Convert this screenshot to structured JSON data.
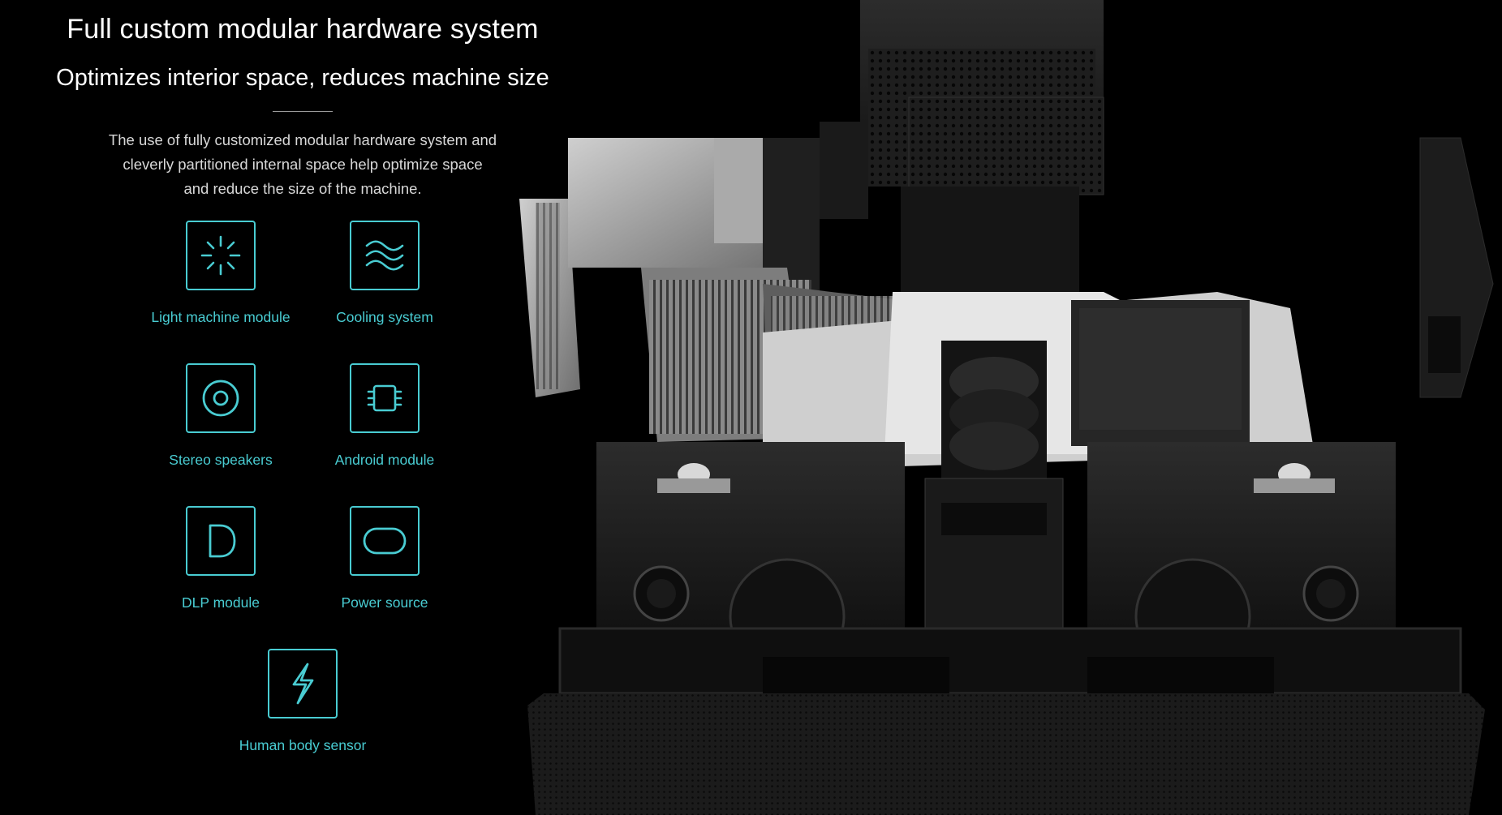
{
  "header": {
    "title": "Full custom modular hardware system",
    "subtitle": "Optimizes interior space, reduces machine size"
  },
  "description": {
    "line1": "The use of fully customized modular hardware system and",
    "line2": "cleverly partitioned internal space help optimize space",
    "line3": "and reduce the size of the machine."
  },
  "features": [
    {
      "label": "Light machine module",
      "icon": "light-burst-icon"
    },
    {
      "label": "Cooling system",
      "icon": "waves-icon"
    },
    {
      "label": "Stereo speakers",
      "icon": "speaker-icon"
    },
    {
      "label": "Android module",
      "icon": "chip-icon"
    },
    {
      "label": "DLP module",
      "icon": "letter-d-icon"
    },
    {
      "label": "Power source",
      "icon": "pill-icon"
    },
    {
      "label": "Human body sensor",
      "icon": "lightning-icon"
    }
  ],
  "colors": {
    "background": "#000000",
    "accent": "#49ccd2",
    "text": "#ffffff"
  }
}
